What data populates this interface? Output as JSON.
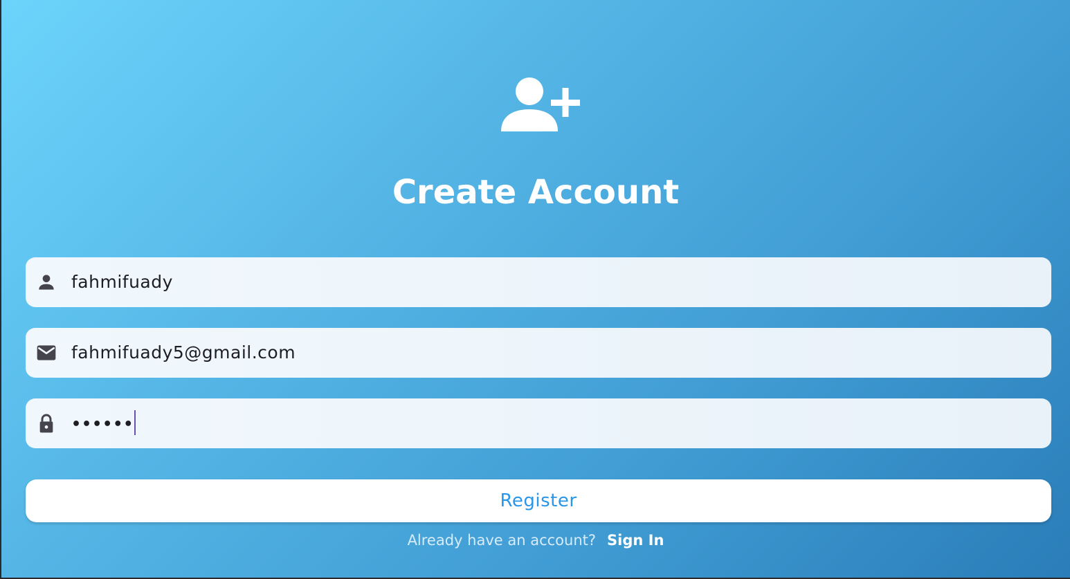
{
  "header": {
    "icon": "person-add-icon",
    "title": "Create Account"
  },
  "form": {
    "username": {
      "icon": "person-icon",
      "value": "fahmifuady"
    },
    "email": {
      "icon": "mail-icon",
      "value": "fahmifuady5@gmail.com"
    },
    "password": {
      "icon": "lock-icon",
      "value": "••••••",
      "focused": true
    }
  },
  "actions": {
    "register_label": "Register"
  },
  "footer": {
    "prompt": "Already have an account?",
    "sign_in_label": "Sign In"
  },
  "colors": {
    "gradient_start": "#6cd4fb",
    "gradient_end": "#2a7db8",
    "accent": "#2a96e8",
    "caret": "#6b4fb0",
    "field_bg": "#f1f8fd"
  }
}
